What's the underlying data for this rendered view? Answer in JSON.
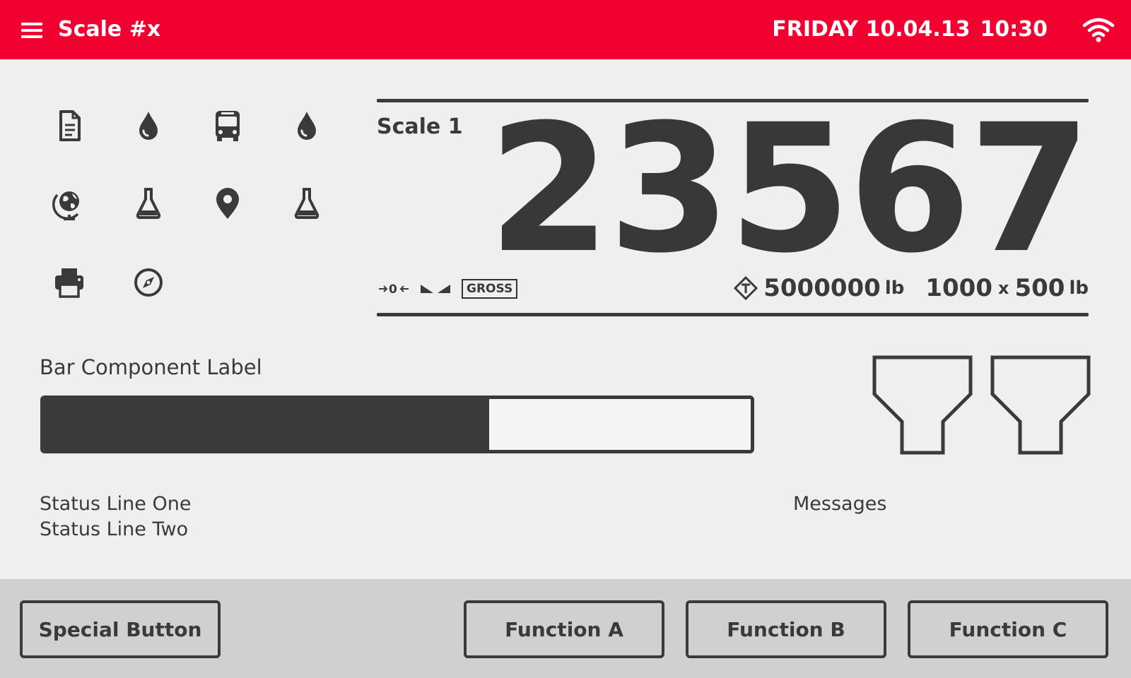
{
  "header": {
    "title": "Scale #x",
    "date": "FRIDAY 10.04.13",
    "time": "10:30"
  },
  "icons": [
    "document-icon",
    "drop-icon",
    "bus-icon",
    "drop-icon",
    "globe-icon",
    "flask-icon",
    "map-pin-icon",
    "flask-icon",
    "printer-icon",
    "compass-icon"
  ],
  "scale": {
    "name": "Scale 1",
    "weight": "23567",
    "mode_badge": "GROSS",
    "capacity": "5000000",
    "capacity_unit": "lb",
    "range_a": "1000",
    "range_x": "x",
    "range_b": "500",
    "range_unit": "lb"
  },
  "bar": {
    "label": "Bar Component Label",
    "fill_fraction": 0.63
  },
  "status": {
    "line1": "Status Line One",
    "line2": "Status Line Two",
    "messages": "Messages"
  },
  "footer": {
    "special": "Special Button",
    "function_a": "Function A",
    "function_b": "Function B",
    "function_c": "Function C"
  },
  "colors": {
    "accent": "#f2002f",
    "ink": "#3a3a3a",
    "background": "#f0eff0",
    "footer": "#d1d0d1"
  }
}
